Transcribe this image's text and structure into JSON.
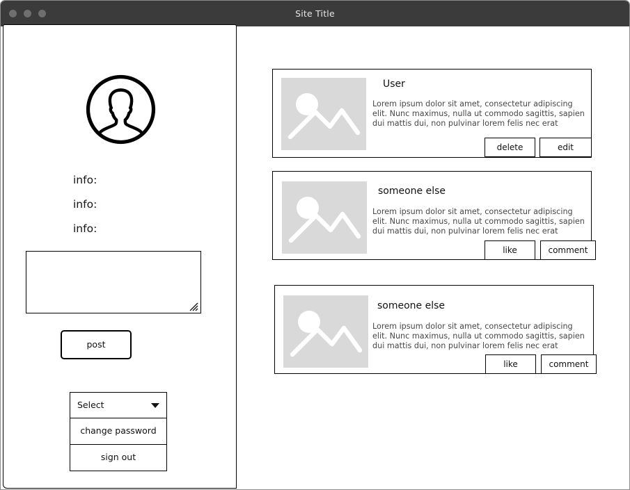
{
  "window": {
    "title": "Site Title",
    "traffic_lights": [
      "close-dot",
      "minimize-dot",
      "maximize-dot"
    ],
    "titlebar_color": "#3b3b3b",
    "dot_color": "#6f6f6f"
  },
  "sidebar": {
    "avatar": {
      "icon": "user-avatar-icon",
      "description": "circular outline portrait silhouette"
    },
    "info_lines": [
      {
        "label": "info:"
      },
      {
        "label": "info:"
      },
      {
        "label": "info:"
      }
    ],
    "composer": {
      "name": "post-textarea",
      "value": "",
      "placeholder": "",
      "resize_grip_icon": "resize-grip-icon"
    },
    "post_button": {
      "label": "post"
    },
    "actions": [
      {
        "name": "select-dropdown",
        "label": "Select",
        "icon": "chevron-down-icon",
        "type": "select"
      },
      {
        "name": "change-password-button",
        "label": "change password",
        "type": "button"
      },
      {
        "name": "sign-out-button",
        "label": "sign out",
        "type": "button"
      }
    ]
  },
  "feed": {
    "placeholder_icon": "image-placeholder-icon",
    "placeholder_color": "#d9d9d9",
    "posts": [
      {
        "user": "User",
        "body": "Lorem ipsum dolor sit amet, consectetur adipiscing elit. Nunc maximus, nulla ut commodo sagittis, sapien dui mattis dui, non pulvinar lorem felis nec erat",
        "actions": [
          {
            "name": "delete-button",
            "label": "delete"
          },
          {
            "name": "edit-button",
            "label": "edit"
          }
        ]
      },
      {
        "user": "someone else",
        "body": "Lorem ipsum dolor sit amet, consectetur adipiscing elit. Nunc maximus, nulla ut commodo sagittis, sapien dui mattis dui, non pulvinar lorem felis nec erat",
        "actions": [
          {
            "name": "like-button",
            "label": "like"
          },
          {
            "name": "comment-button",
            "label": "comment"
          }
        ]
      },
      {
        "user": "someone else",
        "body": "Lorem ipsum dolor sit amet, consectetur adipiscing elit. Nunc maximus, nulla ut commodo sagittis, sapien dui mattis dui, non pulvinar lorem felis nec erat",
        "actions": [
          {
            "name": "like-button",
            "label": "like"
          },
          {
            "name": "comment-button",
            "label": "comment"
          }
        ]
      }
    ]
  }
}
